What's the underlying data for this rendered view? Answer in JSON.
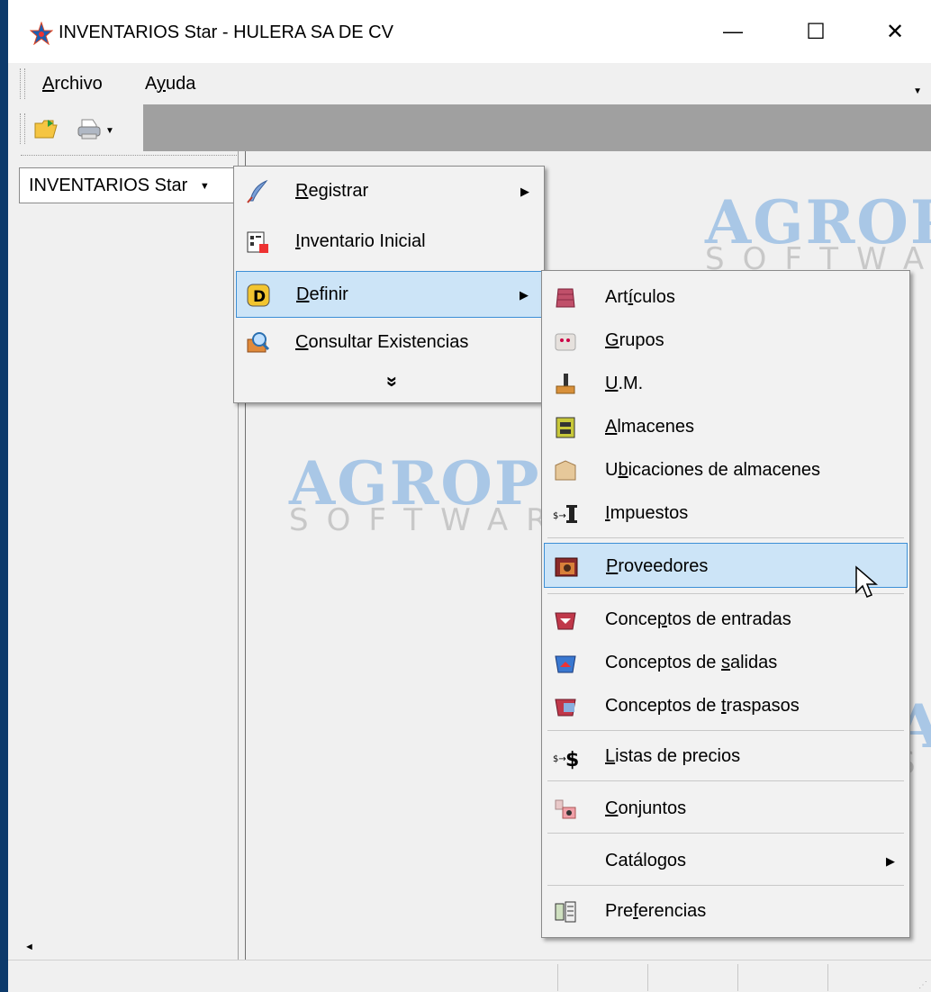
{
  "window": {
    "title": "INVENTARIOS Star - HULERA SA DE CV",
    "minimize": "—",
    "maximize": "☐",
    "close": "✕"
  },
  "menubar": {
    "archivo_pre": "",
    "archivo_ul": "A",
    "archivo_post": "rchivo",
    "ayuda_pre": "A",
    "ayuda_ul": "y",
    "ayuda_post": "uda"
  },
  "panel": {
    "dropdown_label": "INVENTARIOS Star"
  },
  "watermark": {
    "brand": "AGROPEC",
    "sub": "SOFTWARE"
  },
  "main_menu": {
    "registrar": {
      "ul": "R",
      "post": "egistrar"
    },
    "inventario": {
      "ul": "I",
      "post": "nventario Inicial"
    },
    "definir": {
      "ul": "D",
      "post": "efinir"
    },
    "consultar": {
      "ul": "C",
      "post": "onsultar Existencias"
    },
    "expand": "»"
  },
  "sub_menu": {
    "articulos": {
      "pre": "Art",
      "ul": "í",
      "post": "culos"
    },
    "grupos": {
      "pre": "",
      "ul": "G",
      "post": "rupos"
    },
    "um": {
      "pre": "",
      "ul": "U",
      "post": ".M."
    },
    "almacenes": {
      "pre": "",
      "ul": "A",
      "post": "lmacenes"
    },
    "ubicaciones": {
      "pre": "U",
      "ul": "b",
      "post": "icaciones de almacenes"
    },
    "impuestos": {
      "pre": "",
      "ul": "I",
      "post": "mpuestos"
    },
    "proveedores": {
      "pre": "",
      "ul": "P",
      "post": "roveedores"
    },
    "entradas": {
      "pre": "Conce",
      "ul": "p",
      "post": "tos de entradas"
    },
    "salidas": {
      "pre": "Conceptos de ",
      "ul": "s",
      "post": "alidas"
    },
    "traspasos": {
      "pre": "Conceptos de ",
      "ul": "t",
      "post": "raspasos"
    },
    "listas": {
      "pre": "",
      "ul": "L",
      "post": "istas de precios"
    },
    "conjuntos": {
      "pre": "",
      "ul": "C",
      "post": "onjuntos"
    },
    "catalogos": {
      "pre": "Catálogos",
      "ul": "",
      "post": ""
    },
    "preferencias": {
      "pre": "Pre",
      "ul": "f",
      "post": "erencias"
    }
  }
}
